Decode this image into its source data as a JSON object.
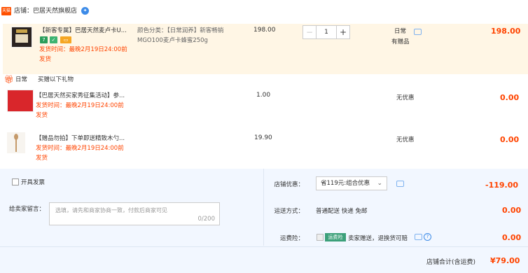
{
  "shop": {
    "logo_text": "天猫",
    "name": "店铺：巴居天然旗舰店",
    "chat_icon": "chat-icon"
  },
  "items": [
    {
      "title": "【新客专属】巴居天然麦卢卡U...",
      "badges": [
        "7",
        "✓",
        "▭"
      ],
      "sku_line1": "颜色分类：【日常润养】新客畅销",
      "sku_line2": "MGO100麦卢卡蜂蜜250g",
      "ship_time": "发货时间：最晚2月19日24:00前",
      "ship_label": "发货",
      "price": "198.00",
      "qty": "1",
      "promo": "日常",
      "promo_sub": "有赠品",
      "total": "198.00"
    }
  ],
  "gift": {
    "tag": "日常",
    "text": "买赠以下礼物"
  },
  "gifts": [
    {
      "title": "【巴居天然买家秀征集活动】参...",
      "ship_time": "发货时间：最晚2月19日24:00前",
      "ship_label": "发货",
      "price": "1.00",
      "discount": "无优惠",
      "total": "0.00"
    },
    {
      "title": "【赠品勿拍】下单即送精致木勺...",
      "ship_time": "发货时间：最晚2月19日24:00前",
      "ship_label": "发货",
      "price": "19.90",
      "discount": "无优惠",
      "total": "0.00"
    }
  ],
  "invoice": {
    "label": "开具发票"
  },
  "message": {
    "label": "给卖家留言：",
    "placeholder": "选填，请先和商家协商一致，付款后商家可见",
    "count": "0/200"
  },
  "shop_discount": {
    "label": "店铺优惠：",
    "value": "省119元:组合优惠",
    "amount": "-119.00"
  },
  "shipping": {
    "label": "运送方式：",
    "value": "普通配送 快递 免邮",
    "amount": "0.00"
  },
  "insurance": {
    "label": "运费险：",
    "tag": "运费险",
    "text": "卖家赠送，退换货可赔",
    "amount": "0.00"
  },
  "summary": {
    "label": "店铺合计(含运费)",
    "amount": "¥79.00"
  },
  "colors": {
    "accent": "#ff4400",
    "panel": "#f2f7ff",
    "item_bg": "#fff6e5"
  }
}
